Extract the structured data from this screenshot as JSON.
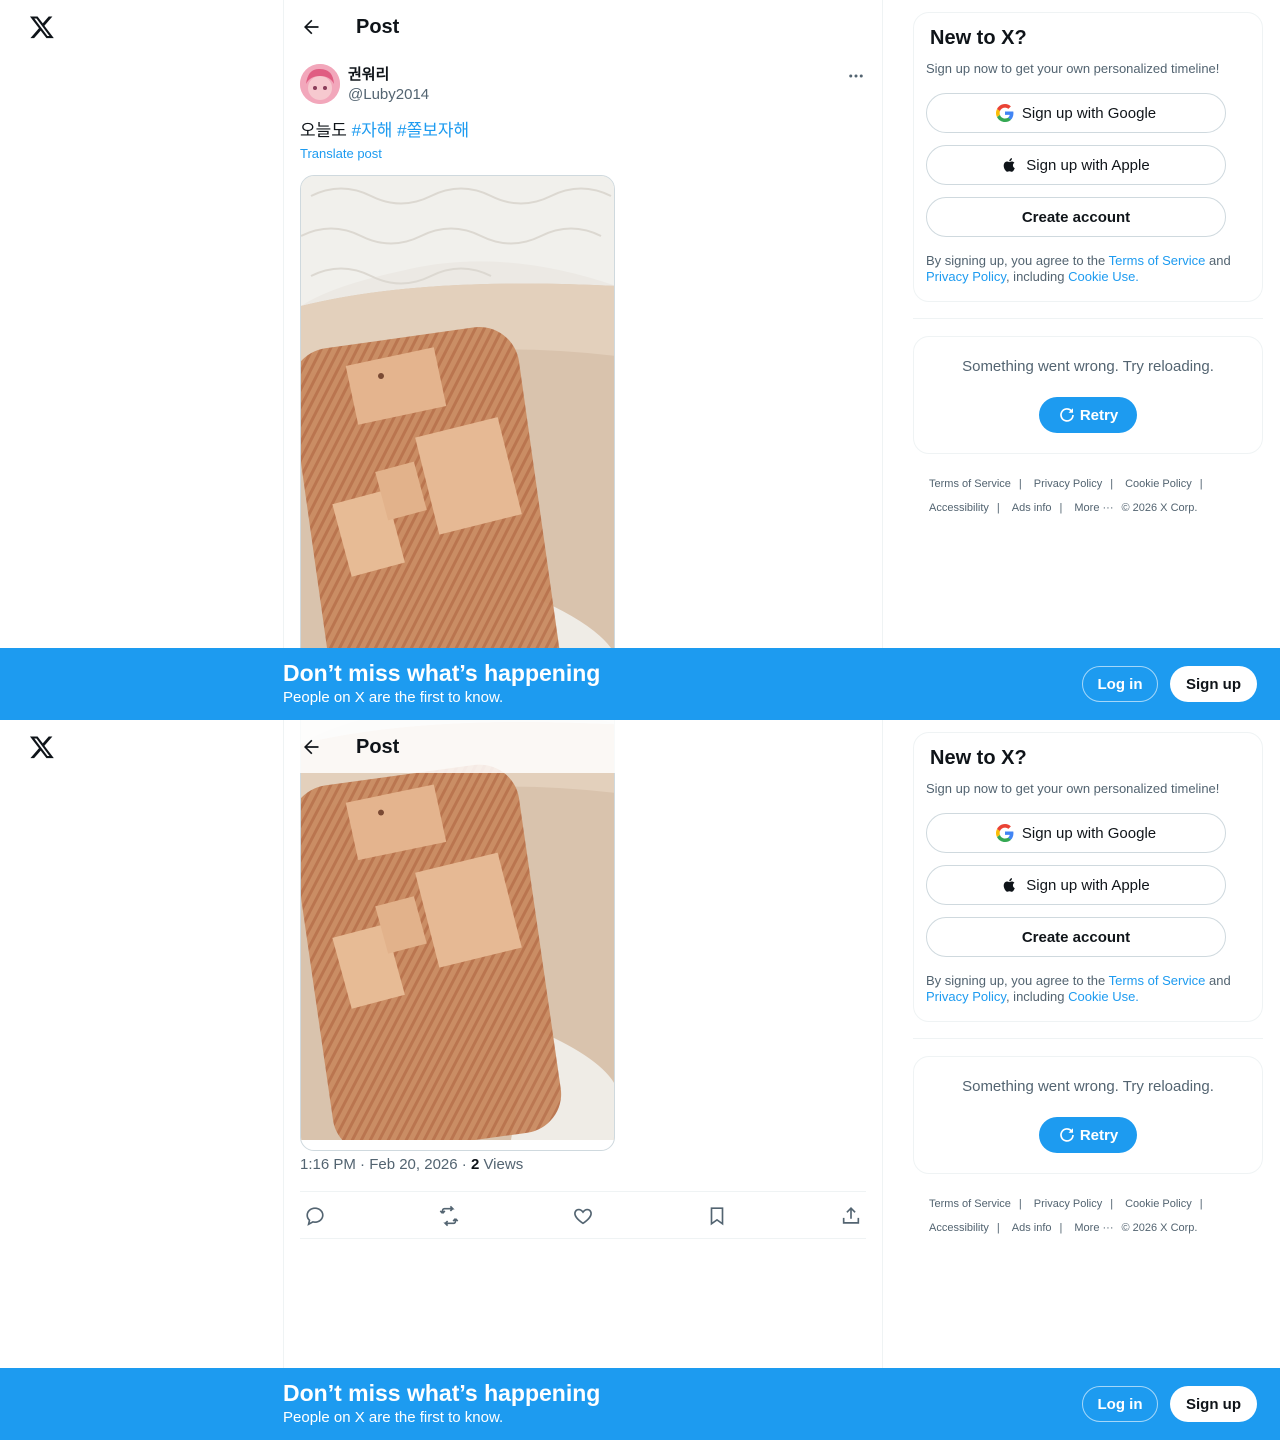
{
  "header": {
    "title": "Post"
  },
  "tweet": {
    "author_name": "권워리",
    "author_handle": "@Luby2014",
    "text_plain": "오늘도 ",
    "hashtag1": "#자해",
    "hashtag2": "#쫄보자해",
    "translate": "Translate post",
    "time": "1:16 PM · Feb 20, 2026 · ",
    "views_count": "2",
    "views_label": " Views"
  },
  "signup": {
    "title": "New to X?",
    "subtitle": "Sign up now to get your own personalized timeline!",
    "google": "Sign up with Google",
    "apple": "Sign up with Apple",
    "create": "Create account",
    "legal_1": "By signing up, you agree to the ",
    "legal_tos": "Terms of Service",
    "legal_2": " and ",
    "legal_pp": "Privacy Policy",
    "legal_3": ", including ",
    "legal_cookie": "Cookie Use."
  },
  "error": {
    "message": "Something went wrong. Try reloading.",
    "retry": "Retry"
  },
  "footer": {
    "tos": "Terms of Service",
    "privacy": "Privacy Policy",
    "cookie": "Cookie Policy",
    "accessibility": "Accessibility",
    "ads": "Ads info",
    "more": "More ···",
    "copyright": "© 2026 X Corp."
  },
  "banner": {
    "title": "Don’t miss what’s happening",
    "subtitle": "People on X are the first to know.",
    "login": "Log in",
    "signup": "Sign up"
  },
  "colors": {
    "accent": "#1d9bf0",
    "text": "#0f1419",
    "muted": "#536471",
    "border": "#eff3f4"
  }
}
